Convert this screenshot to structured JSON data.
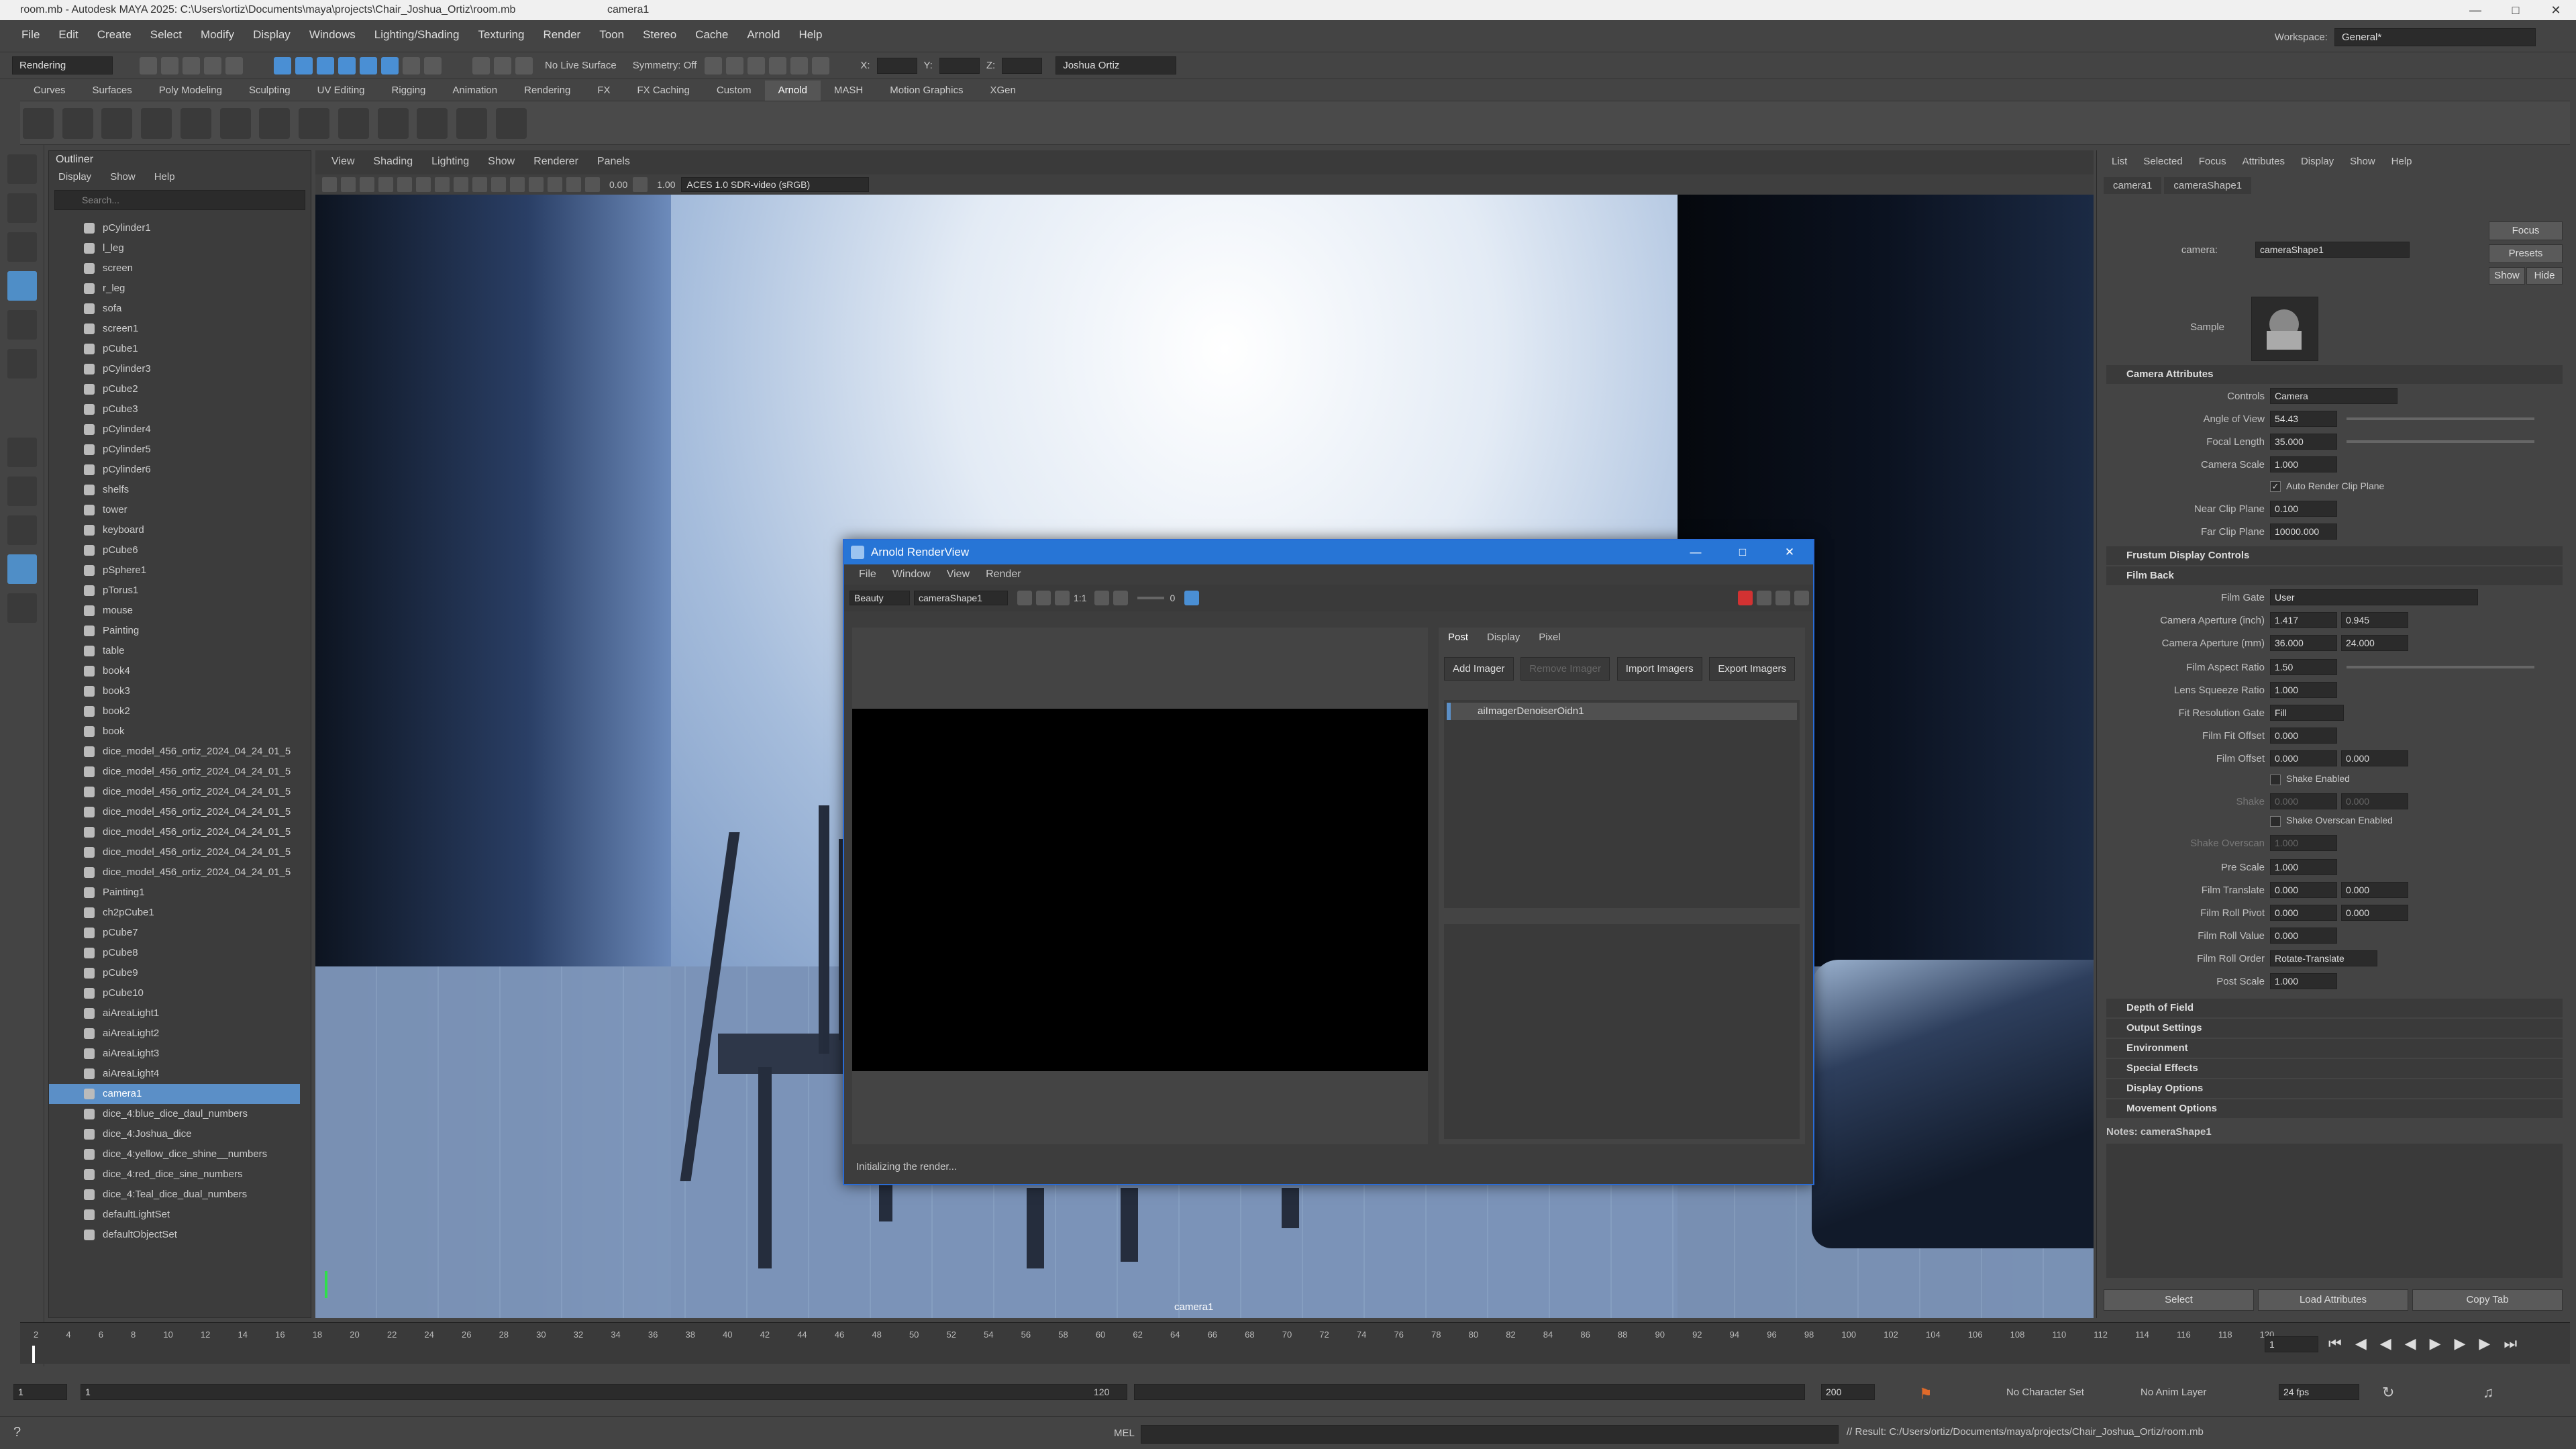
{
  "window": {
    "title": "room.mb - Autodesk MAYA 2025: C:\\Users\\ortiz\\Documents\\maya\\projects\\Chair_Joshua_Ortiz\\room.mb",
    "camera": "camera1"
  },
  "menus": [
    "File",
    "Edit",
    "Create",
    "Select",
    "Modify",
    "Display",
    "Windows",
    "Lighting/Shading",
    "Texturing",
    "Render",
    "Toon",
    "Stereo",
    "Cache",
    "Arnold",
    "Help"
  ],
  "workspace": {
    "label": "Workspace:",
    "value": "General*"
  },
  "statusline": {
    "mode": "Rendering",
    "live_surface": "No Live Surface",
    "symmetry": "Symmetry: Off",
    "x": "X:",
    "y": "Y:",
    "z": "Z:",
    "user": "Joshua Ortiz"
  },
  "shelf_tabs": [
    "Curves",
    "Surfaces",
    "Poly Modeling",
    "Sculpting",
    "UV Editing",
    "Rigging",
    "Animation",
    "Rendering",
    "FX",
    "FX Caching",
    "Custom",
    "Arnold",
    "MASH",
    "Motion Graphics",
    "XGen"
  ],
  "outliner": {
    "title": "Outliner",
    "menu": [
      "Display",
      "Show",
      "Help"
    ],
    "search_placeholder": "Search...",
    "items": [
      "pCylinder1",
      "l_leg",
      "screen",
      "r_leg",
      "sofa",
      "screen1",
      "pCube1",
      "pCylinder3",
      "pCube2",
      "pCube3",
      "pCylinder4",
      "pCylinder5",
      "pCylinder6",
      "shelfs",
      "tower",
      "keyboard",
      "pCube6",
      "pSphere1",
      "pTorus1",
      "mouse",
      "Painting",
      "table",
      "book4",
      "book3",
      "book2",
      "book",
      "dice_model_456_ortiz_2024_04_24_01_5",
      "dice_model_456_ortiz_2024_04_24_01_5",
      "dice_model_456_ortiz_2024_04_24_01_5",
      "dice_model_456_ortiz_2024_04_24_01_5",
      "dice_model_456_ortiz_2024_04_24_01_5",
      "dice_model_456_ortiz_2024_04_24_01_5",
      "dice_model_456_ortiz_2024_04_24_01_5",
      "Painting1",
      "ch2pCube1",
      "pCube7",
      "pCube8",
      "pCube9",
      "pCube10",
      "aiAreaLight1",
      "aiAreaLight2",
      "aiAreaLight3",
      "aiAreaLight4",
      "camera1",
      "dice_4:blue_dice_daul_numbers",
      "dice_4:Joshua_dice",
      "dice_4:yellow_dice_shine__numbers",
      "dice_4:red_dice_sine_numbers",
      "dice_4:Teal_dice_dual_numbers",
      "defaultLightSet",
      "defaultObjectSet"
    ],
    "selected": "camera1"
  },
  "viewport": {
    "menu": [
      "View",
      "Shading",
      "Lighting",
      "Show",
      "Renderer",
      "Panels"
    ],
    "exposure": "0.00",
    "gamma": "1.00",
    "colorspace": "ACES 1.0 SDR-video (sRGB)",
    "camera_label": "camera1"
  },
  "renderview": {
    "title": "Arnold RenderView",
    "menu": [
      "File",
      "Window",
      "View",
      "Render"
    ],
    "aov": "Beauty",
    "camera": "cameraShape1",
    "ratio": "1:1",
    "value": "0",
    "tabs": [
      "Post",
      "Display",
      "Pixel"
    ],
    "buttons": {
      "add": "Add Imager",
      "remove": "Remove Imager",
      "import": "Import Imagers",
      "export": "Export Imagers"
    },
    "imager": "aiImagerDenoiserOidn1",
    "status": "Initializing the render..."
  },
  "attr": {
    "menu": [
      "List",
      "Selected",
      "Focus",
      "Attributes",
      "Display",
      "Show",
      "Help"
    ],
    "tabs": [
      "camera1",
      "cameraShape1"
    ],
    "camera_label": "camera:",
    "camera_value": "cameraShape1",
    "buttons": [
      "Focus",
      "Presets",
      "Show",
      "Hide"
    ],
    "sample": "Sample",
    "sections": {
      "camera_attributes": "Camera Attributes",
      "frustum": "Frustum Display Controls",
      "film_back": "Film Back",
      "depth": "Depth of Field",
      "output": "Output Settings",
      "environment": "Environment",
      "special": "Special Effects",
      "display": "Display Options",
      "movement": "Movement Options"
    },
    "controls": {
      "label": "Controls",
      "value": "Camera"
    },
    "angle_of_view": {
      "label": "Angle of View",
      "value": "54.43"
    },
    "focal_length": {
      "label": "Focal Length",
      "value": "35.000"
    },
    "camera_scale": {
      "label": "Camera Scale",
      "value": "1.000"
    },
    "auto_clip": "Auto Render Clip Plane",
    "near_clip": {
      "label": "Near Clip Plane",
      "value": "0.100"
    },
    "far_clip": {
      "label": "Far Clip Plane",
      "value": "10000.000"
    },
    "film_gate": {
      "label": "Film Gate",
      "value": "User"
    },
    "aperture_inch": {
      "label": "Camera Aperture (inch)",
      "v1": "1.417",
      "v2": "0.945"
    },
    "aperture_mm": {
      "label": "Camera Aperture (mm)",
      "v1": "36.000",
      "v2": "24.000"
    },
    "aspect": {
      "label": "Film Aspect Ratio",
      "value": "1.50"
    },
    "squeeze": {
      "label": "Lens Squeeze Ratio",
      "value": "1.000"
    },
    "fit_gate": {
      "label": "Fit Resolution Gate",
      "value": "Fill"
    },
    "fit_offset": {
      "label": "Film Fit Offset",
      "value": "0.000"
    },
    "film_offset": {
      "label": "Film Offset",
      "v1": "0.000",
      "v2": "0.000"
    },
    "shake_enabled": "Shake Enabled",
    "shake": {
      "label": "Shake",
      "v1": "0.000",
      "v2": "0.000"
    },
    "shake_overscan_enabled": "Shake Overscan Enabled",
    "shake_overscan": {
      "label": "Shake Overscan",
      "value": "1.000"
    },
    "pre_scale": {
      "label": "Pre Scale",
      "value": "1.000"
    },
    "film_translate": {
      "label": "Film Translate",
      "v1": "0.000",
      "v2": "0.000"
    },
    "roll_pivot": {
      "label": "Film Roll Pivot",
      "v1": "0.000",
      "v2": "0.000"
    },
    "roll_value": {
      "label": "Film Roll Value",
      "value": "0.000"
    },
    "roll_order": {
      "label": "Film Roll Order",
      "value": "Rotate-Translate"
    },
    "post_scale": {
      "label": "Post Scale",
      "value": "1.000"
    },
    "notes": "Notes: cameraShape1",
    "bottom": [
      "Select",
      "Load Attributes",
      "Copy Tab"
    ]
  },
  "timeline": {
    "ticks": [
      "2",
      "4",
      "6",
      "8",
      "10",
      "12",
      "14",
      "16",
      "18",
      "20",
      "22",
      "24",
      "26",
      "28",
      "30",
      "32",
      "34",
      "36",
      "38",
      "40",
      "42",
      "44",
      "46",
      "48",
      "50",
      "52",
      "54",
      "56",
      "58",
      "60",
      "62",
      "64",
      "66",
      "68",
      "70",
      "72",
      "74",
      "76",
      "78",
      "80",
      "82",
      "84",
      "86",
      "88",
      "90",
      "92",
      "94",
      "96",
      "98",
      "100",
      "102",
      "104",
      "106",
      "108",
      "110",
      "112",
      "114",
      "116",
      "118",
      "120"
    ],
    "current": "1",
    "start": "1",
    "range_start": "1",
    "range_end": "120",
    "end": "200",
    "char_set": "No Character Set",
    "anim_layer": "No Anim Layer",
    "fps": "24 fps"
  },
  "mel": {
    "label": "MEL",
    "result": "// Result: C:/Users/ortiz/Documents/maya/projects/Chair_Joshua_Ortiz/room.mb"
  }
}
